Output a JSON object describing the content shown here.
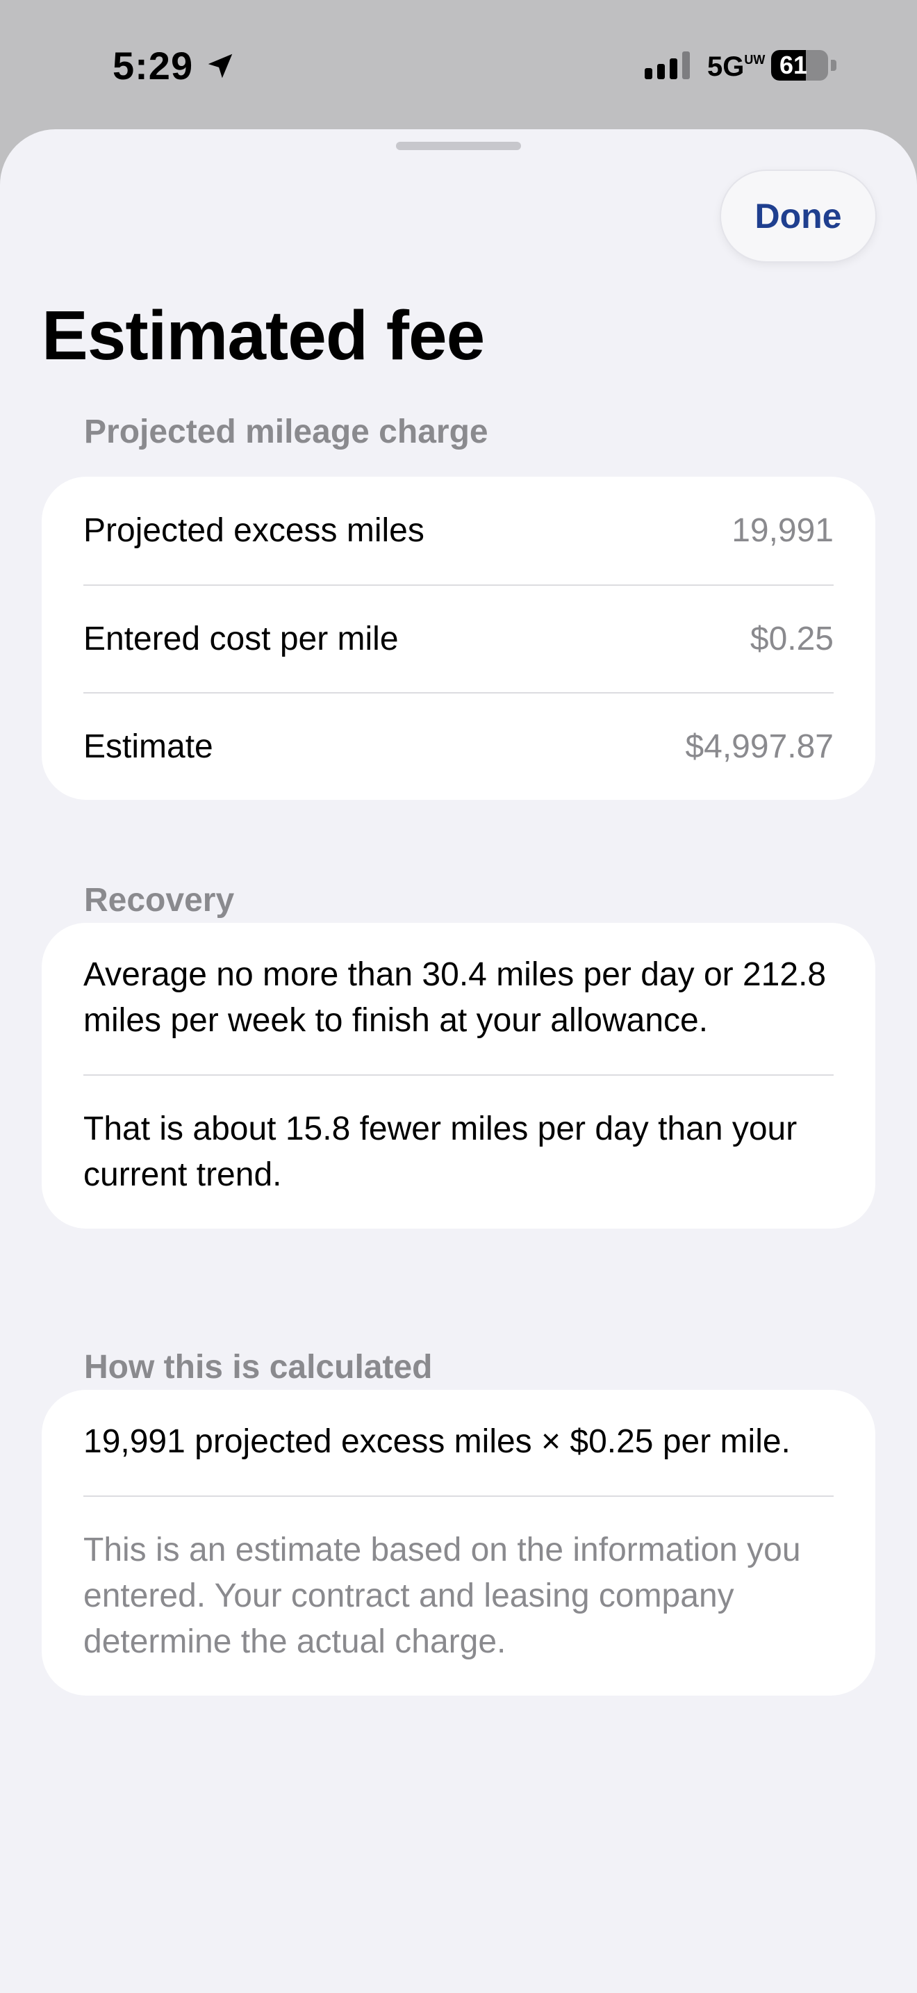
{
  "status_bar": {
    "time": "5:29",
    "network": "5G",
    "network_suffix": "UW",
    "battery_percent": "61",
    "battery_level": 0.61,
    "signal_bars_active": 3,
    "signal_bars_total": 4
  },
  "sheet": {
    "done_label": "Done",
    "title": "Estimated fee"
  },
  "sections": {
    "mileage": {
      "header": "Projected mileage charge",
      "rows": [
        {
          "label": "Projected excess miles",
          "value": "19,991"
        },
        {
          "label": "Entered cost per mile",
          "value": "$0.25"
        },
        {
          "label": "Estimate",
          "value": "$4,997.87"
        }
      ]
    },
    "recovery": {
      "header": "Recovery",
      "lines": [
        "Average no more than 30.4 miles per day or 212.8 miles per week to finish at your allowance.",
        "That is about 15.8 fewer miles per day than your current trend."
      ]
    },
    "calculation": {
      "header": "How this is calculated",
      "formula": "19,991 projected excess miles × $0.25 per mile.",
      "disclaimer": "This is an estimate based on the information you entered. Your contract and leasing company determine the actual charge."
    }
  },
  "colors": {
    "accent": "#1f3f8f",
    "secondary_text": "#8a8a8e",
    "sheet_background": "#f2f2f7",
    "card_background": "#ffffff"
  }
}
